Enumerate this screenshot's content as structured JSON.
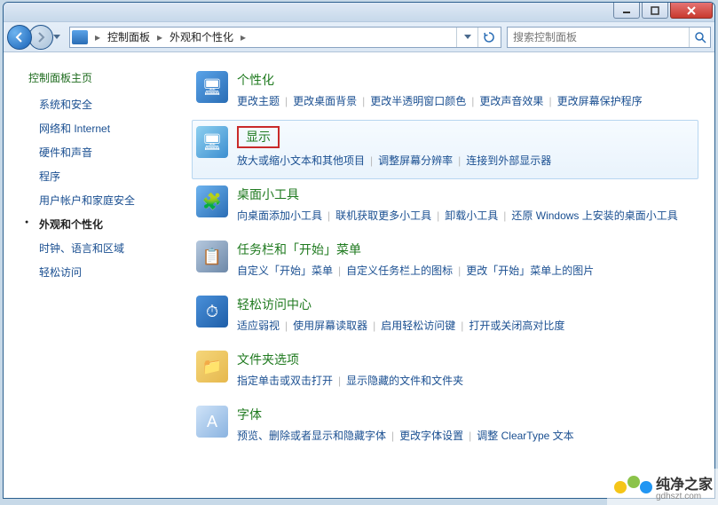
{
  "window": {
    "min": "–",
    "max": "☐",
    "close": "✕"
  },
  "breadcrumbs": [
    "控制面板",
    "外观和个性化"
  ],
  "search": {
    "placeholder": "搜索控制面板"
  },
  "sidebar": {
    "home": "控制面板主页",
    "items": [
      {
        "label": "系统和安全",
        "active": false
      },
      {
        "label": "网络和 Internet",
        "active": false
      },
      {
        "label": "硬件和声音",
        "active": false
      },
      {
        "label": "程序",
        "active": false
      },
      {
        "label": "用户帐户和家庭安全",
        "active": false
      },
      {
        "label": "外观和个性化",
        "active": true
      },
      {
        "label": "时钟、语言和区域",
        "active": false
      },
      {
        "label": "轻松访问",
        "active": false
      }
    ]
  },
  "categories": [
    {
      "title": "个性化",
      "links": [
        "更改主题",
        "更改桌面背景",
        "更改半透明窗口颜色",
        "更改声音效果",
        "更改屏幕保护程序"
      ]
    },
    {
      "title": "显示",
      "highlighted": true,
      "redbox": true,
      "links": [
        "放大或缩小文本和其他项目",
        "调整屏幕分辨率",
        "连接到外部显示器"
      ]
    },
    {
      "title": "桌面小工具",
      "links": [
        "向桌面添加小工具",
        "联机获取更多小工具",
        "卸载小工具",
        "还原 Windows 上安装的桌面小工具"
      ]
    },
    {
      "title": "任务栏和「开始」菜单",
      "links": [
        "自定义「开始」菜单",
        "自定义任务栏上的图标",
        "更改「开始」菜单上的图片"
      ]
    },
    {
      "title": "轻松访问中心",
      "links": [
        "适应弱视",
        "使用屏幕读取器",
        "启用轻松访问键",
        "打开或关闭高对比度"
      ]
    },
    {
      "title": "文件夹选项",
      "links": [
        "指定单击或双击打开",
        "显示隐藏的文件和文件夹"
      ]
    },
    {
      "title": "字体",
      "links": [
        "预览、删除或者显示和隐藏字体",
        "更改字体设置",
        "调整 ClearType 文本"
      ]
    }
  ],
  "watermark": {
    "brand": "纯净之家",
    "url": "gdhszt.com"
  }
}
